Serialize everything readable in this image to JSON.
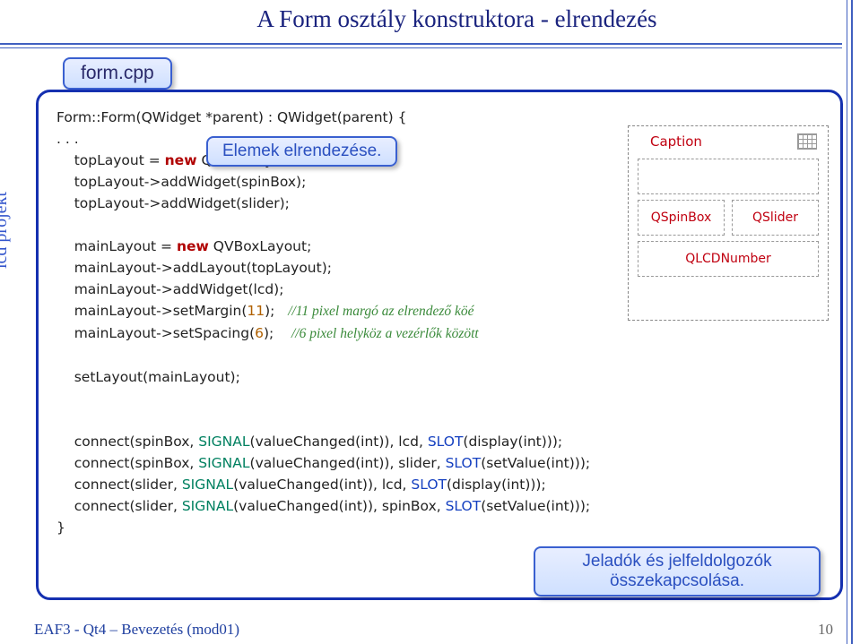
{
  "title": "A Form osztály konstruktora - elrendezés",
  "side_label": "lcd projekt",
  "filename": "form.cpp",
  "callout_layout": "Elemek elrendezése.",
  "callout_signals": "Jeladók és jelfeldolgozók összekapcsolása.",
  "footer": "EAF3 - Qt4 – Bevezetés (mod01)",
  "page_number": "10",
  "diagram": {
    "caption": "Caption",
    "spin": "QSpinBox",
    "slider": "QSlider",
    "lcd": "QLCDNumber"
  },
  "code": {
    "l1a": "Form::Form(QWidget *parent) : QWidget(parent) {",
    "l2": ". . .",
    "l3a": "    topLayout = ",
    "l3b": "new",
    "l3c": " QHBoxLayout;",
    "l4": "    topLayout->addWidget(spinBox);",
    "l5": "    topLayout->addWidget(slider);",
    "l6": " ",
    "l7a": "    mainLayout = ",
    "l7b": "new",
    "l7c": " QVBoxLayout;",
    "l8": "    mainLayout->addLayout(topLayout);",
    "l9": "    mainLayout->addWidget(lcd);",
    "l10a": "    mainLayout->setMargin(",
    "l10b": "11",
    "l10c": ");   ",
    "l10d": "//11 pixel margó az elrendező köé",
    "l11a": "    mainLayout->setSpacing(",
    "l11b": "6",
    "l11c": ");    ",
    "l11d": "//6 pixel helyköz a vezérlők között",
    "l12": " ",
    "l13": "    setLayout(mainLayout);",
    "l14": " ",
    "l15": " ",
    "c1a": "    connect(spinBox, ",
    "c1s": "SIGNAL",
    "c1b": "(valueChanged(int)), lcd, ",
    "c1t": "SLOT",
    "c1c": "(display(int)));",
    "c2a": "    connect(spinBox, ",
    "c2s": "SIGNAL",
    "c2b": "(valueChanged(int)), slider, ",
    "c2t": "SLOT",
    "c2c": "(setValue(int)));",
    "c3a": "    connect(slider, ",
    "c3s": "SIGNAL",
    "c3b": "(valueChanged(int)), lcd, ",
    "c3t": "SLOT",
    "c3c": "(display(int)));",
    "c4a": "    connect(slider, ",
    "c4s": "SIGNAL",
    "c4b": "(valueChanged(int)), spinBox, ",
    "c4t": "SLOT",
    "c4c": "(setValue(int)));",
    "lend": "}"
  }
}
